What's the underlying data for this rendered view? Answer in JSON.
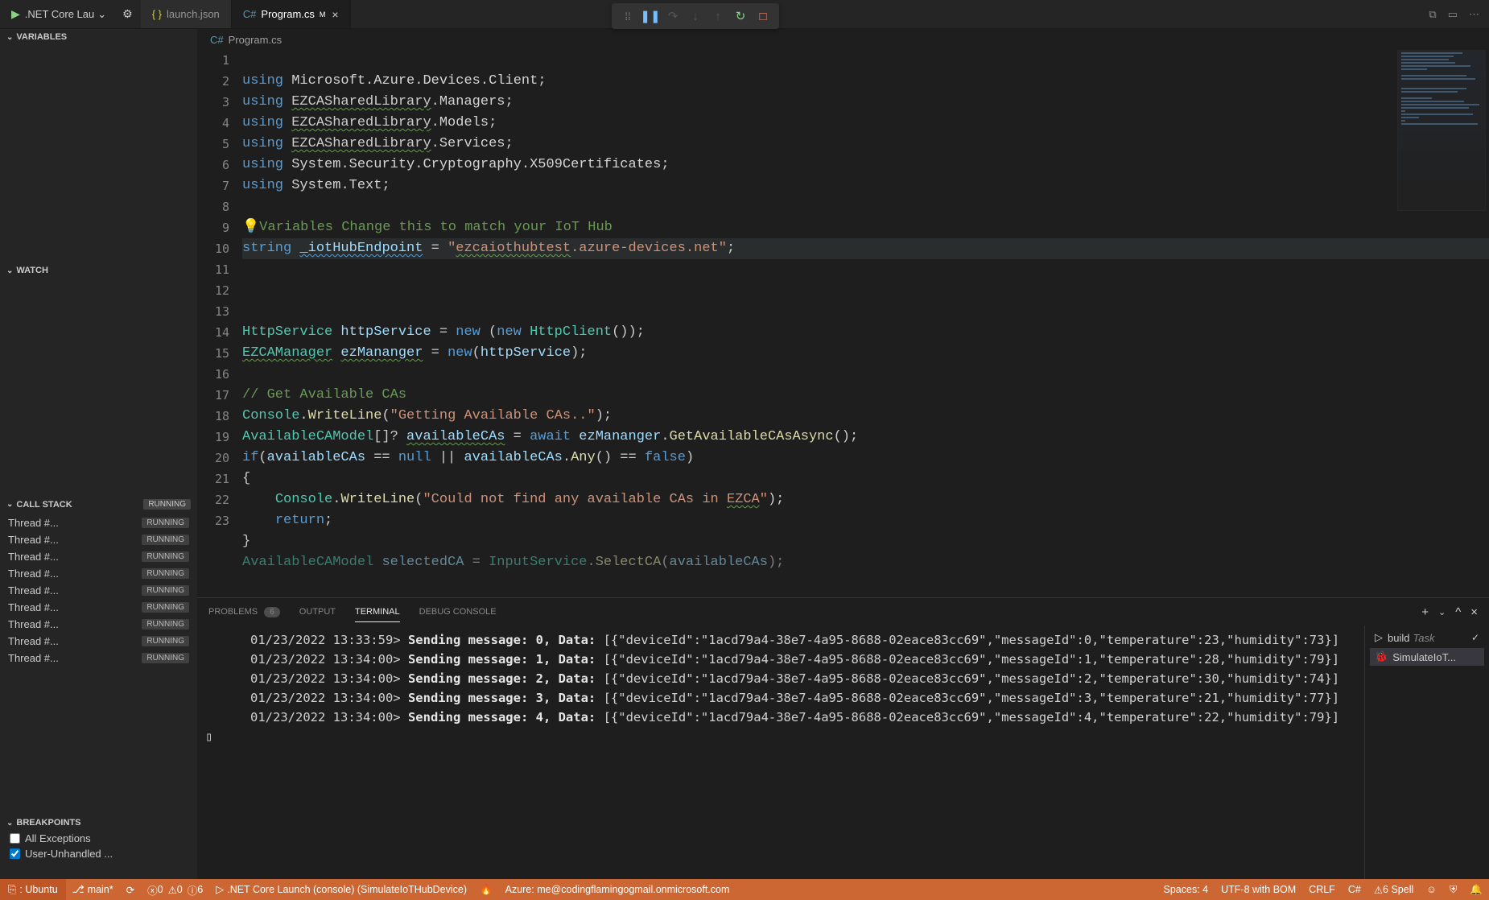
{
  "titlebar": {
    "run_label": ".NET Core Lau",
    "tabs": [
      {
        "label": "launch.json",
        "active": false,
        "type": "json"
      },
      {
        "label": "Program.cs",
        "active": true,
        "type": "cs",
        "modified": "M"
      }
    ]
  },
  "breadcrumb": {
    "file": "Program.cs"
  },
  "code": {
    "lines": [
      1,
      2,
      3,
      4,
      5,
      6,
      7,
      8,
      9,
      10,
      11,
      12,
      13,
      14,
      15,
      16,
      17,
      18,
      19,
      20,
      21,
      22,
      23
    ]
  },
  "sidebar": {
    "variables_label": "VARIABLES",
    "watch_label": "WATCH",
    "callstack_label": "CALL STACK",
    "callstack_status": "RUNNING",
    "threads": [
      {
        "name": "Thread #...",
        "status": "RUNNING"
      },
      {
        "name": "Thread #...",
        "status": "RUNNING"
      },
      {
        "name": "Thread #...",
        "status": "RUNNING"
      },
      {
        "name": "Thread #...",
        "status": "RUNNING"
      },
      {
        "name": "Thread #...",
        "status": "RUNNING"
      },
      {
        "name": "Thread #...",
        "status": "RUNNING"
      },
      {
        "name": "Thread #...",
        "status": "RUNNING"
      },
      {
        "name": "Thread #...",
        "status": "RUNNING"
      },
      {
        "name": "Thread #...",
        "status": "RUNNING"
      }
    ],
    "breakpoints_label": "BREAKPOINTS",
    "bp_all": "All Exceptions",
    "bp_user": "User-Unhandled ..."
  },
  "panel": {
    "tabs": {
      "problems": "PROBLEMS",
      "problems_badge": "6",
      "output": "OUTPUT",
      "terminal": "TERMINAL",
      "debug": "DEBUG CONSOLE"
    },
    "terminal_side": {
      "build": "build",
      "build_sub": "Task",
      "sim": "SimulateIoT..."
    },
    "terminal_lines": [
      "      01/23/2022 13:33:59> Sending message: 0, Data: [{\"deviceId\":\"1acd79a4-38e7-4a95-8688-02eace83cc69\",\"messageId\":0,\"temperature\":23,\"humidity\":73}]",
      "      01/23/2022 13:34:00> Sending message: 1, Data: [{\"deviceId\":\"1acd79a4-38e7-4a95-8688-02eace83cc69\",\"messageId\":1,\"temperature\":28,\"humidity\":79}]",
      "      01/23/2022 13:34:00> Sending message: 2, Data: [{\"deviceId\":\"1acd79a4-38e7-4a95-8688-02eace83cc69\",\"messageId\":2,\"temperature\":30,\"humidity\":74}]",
      "      01/23/2022 13:34:00> Sending message: 3, Data: [{\"deviceId\":\"1acd79a4-38e7-4a95-8688-02eace83cc69\",\"messageId\":3,\"temperature\":21,\"humidity\":77}]",
      "      01/23/2022 13:34:00> Sending message: 4, Data: [{\"deviceId\":\"1acd79a4-38e7-4a95-8688-02eace83cc69\",\"messageId\":4,\"temperature\":22,\"humidity\":79}]"
    ]
  },
  "statusbar": {
    "remote": ": Ubuntu",
    "branch": "main*",
    "errors": "0",
    "warnings": "0",
    "info": "6",
    "launch": ".NET Core Launch (console) (SimulateIoTHubDevice)",
    "azure": "Azure: me@codingflamingogmail.onmicrosoft.com",
    "spaces": "Spaces: 4",
    "encoding": "UTF-8 with BOM",
    "eol": "CRLF",
    "lang": "C#",
    "spell": "6 Spell"
  }
}
